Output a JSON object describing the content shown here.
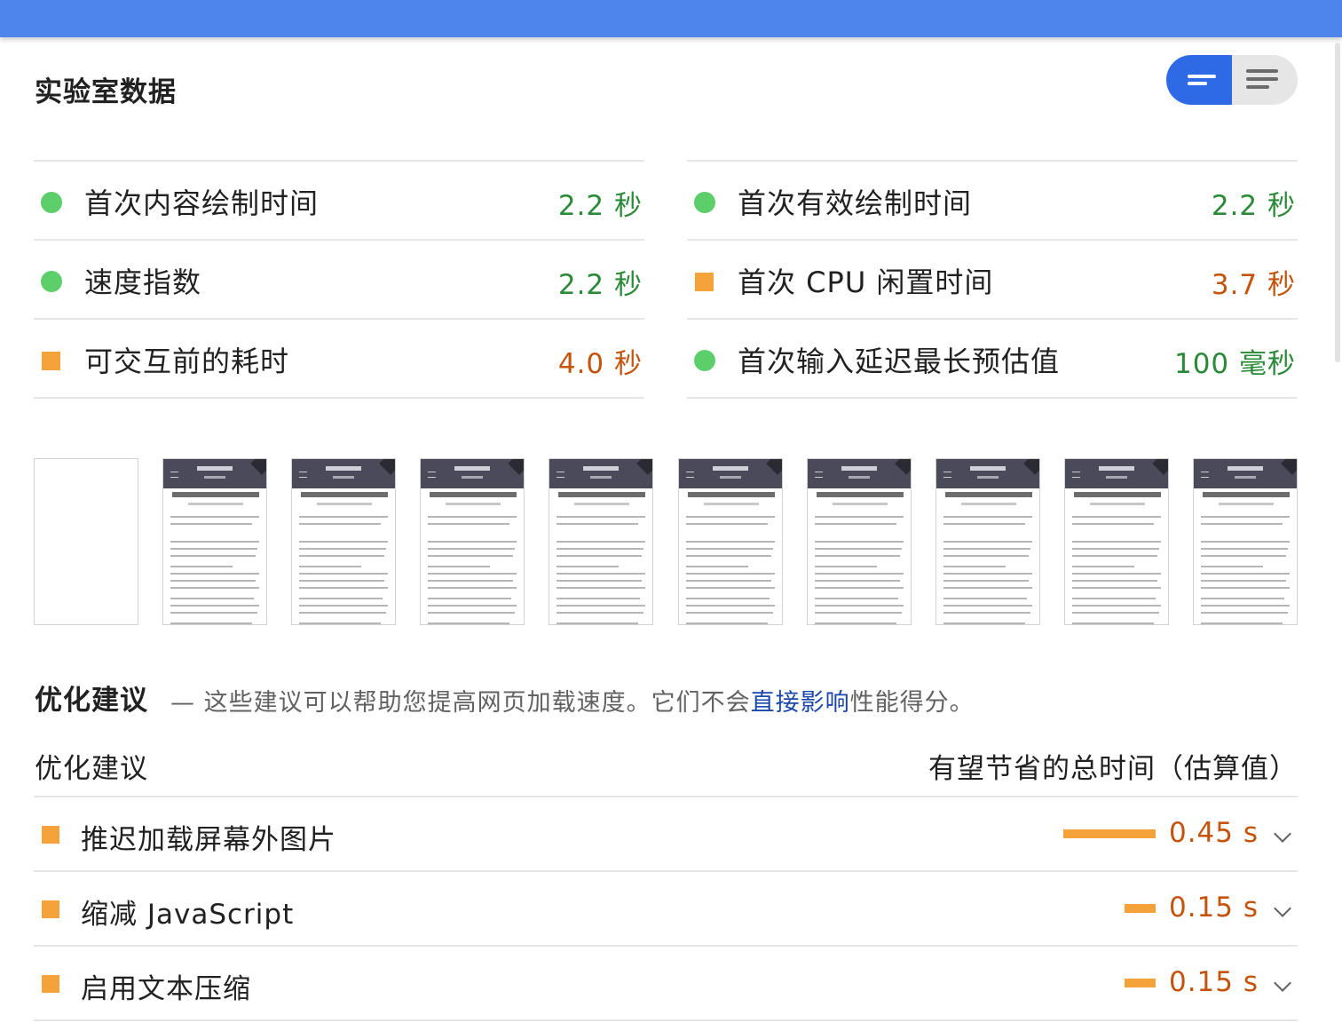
{
  "lab_data": {
    "title": "实验室数据",
    "metrics_left": [
      {
        "label": "首次内容绘制时间",
        "value": "2.2 秒",
        "status": "pass"
      },
      {
        "label": "速度指数",
        "value": "2.2 秒",
        "status": "pass"
      },
      {
        "label": "可交互前的耗时",
        "value": "4.0 秒",
        "status": "average"
      }
    ],
    "metrics_right": [
      {
        "label": "首次有效绘制时间",
        "value": "2.2 秒",
        "status": "pass"
      },
      {
        "label": "首次 CPU 闲置时间",
        "value": "3.7 秒",
        "status": "average"
      },
      {
        "label": "首次输入延迟最长预估值",
        "value": "100 毫秒",
        "status": "pass"
      }
    ]
  },
  "filmstrip": {
    "frames": 10,
    "blank_frames": 1
  },
  "opportunities": {
    "title": "优化建议",
    "description_prefix": "— 这些建议可以帮助您提高网页加载速度。它们不会",
    "description_link": "直接影响",
    "description_suffix": "性能得分。",
    "column_left": "优化建议",
    "column_right": "有望节省的总时间（估算值）",
    "items": [
      {
        "label": "推迟加载屏幕外图片",
        "saving": "0.45 s",
        "saving_value": 0.45
      },
      {
        "label": "缩减 JavaScript",
        "saving": "0.15 s",
        "saving_value": 0.15
      },
      {
        "label": "启用文本压缩",
        "saving": "0.15 s",
        "saving_value": 0.15
      }
    ]
  },
  "colors": {
    "header_blue": "#4e85ec",
    "pass_green": "#5cce6a",
    "average_orange": "#f4a33a",
    "toggle_active": "#2f6ae6"
  },
  "icons": {
    "toggle_left": "compact-view-icon",
    "toggle_right": "list-view-icon",
    "expand": "chevron-down-icon"
  }
}
